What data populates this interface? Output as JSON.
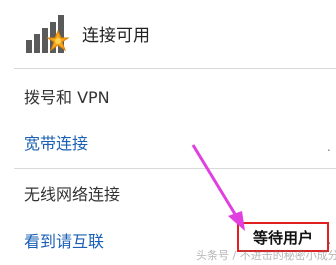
{
  "status": {
    "text": "连接可用",
    "icon": "wifi-signal-starburst-icon"
  },
  "sections": {
    "dialup": "拨号和 VPN",
    "broadband": "宽带连接",
    "wireless": "无线网络连接",
    "wireless_network": "看到请互联"
  },
  "annotation": {
    "waiting_user": "等待用户"
  },
  "watermark": "头条号 / 不进击的秘密小成分享",
  "colors": {
    "link": "#1a5fb4",
    "highlight_border": "#e02020",
    "arrow": "#e040e0"
  }
}
